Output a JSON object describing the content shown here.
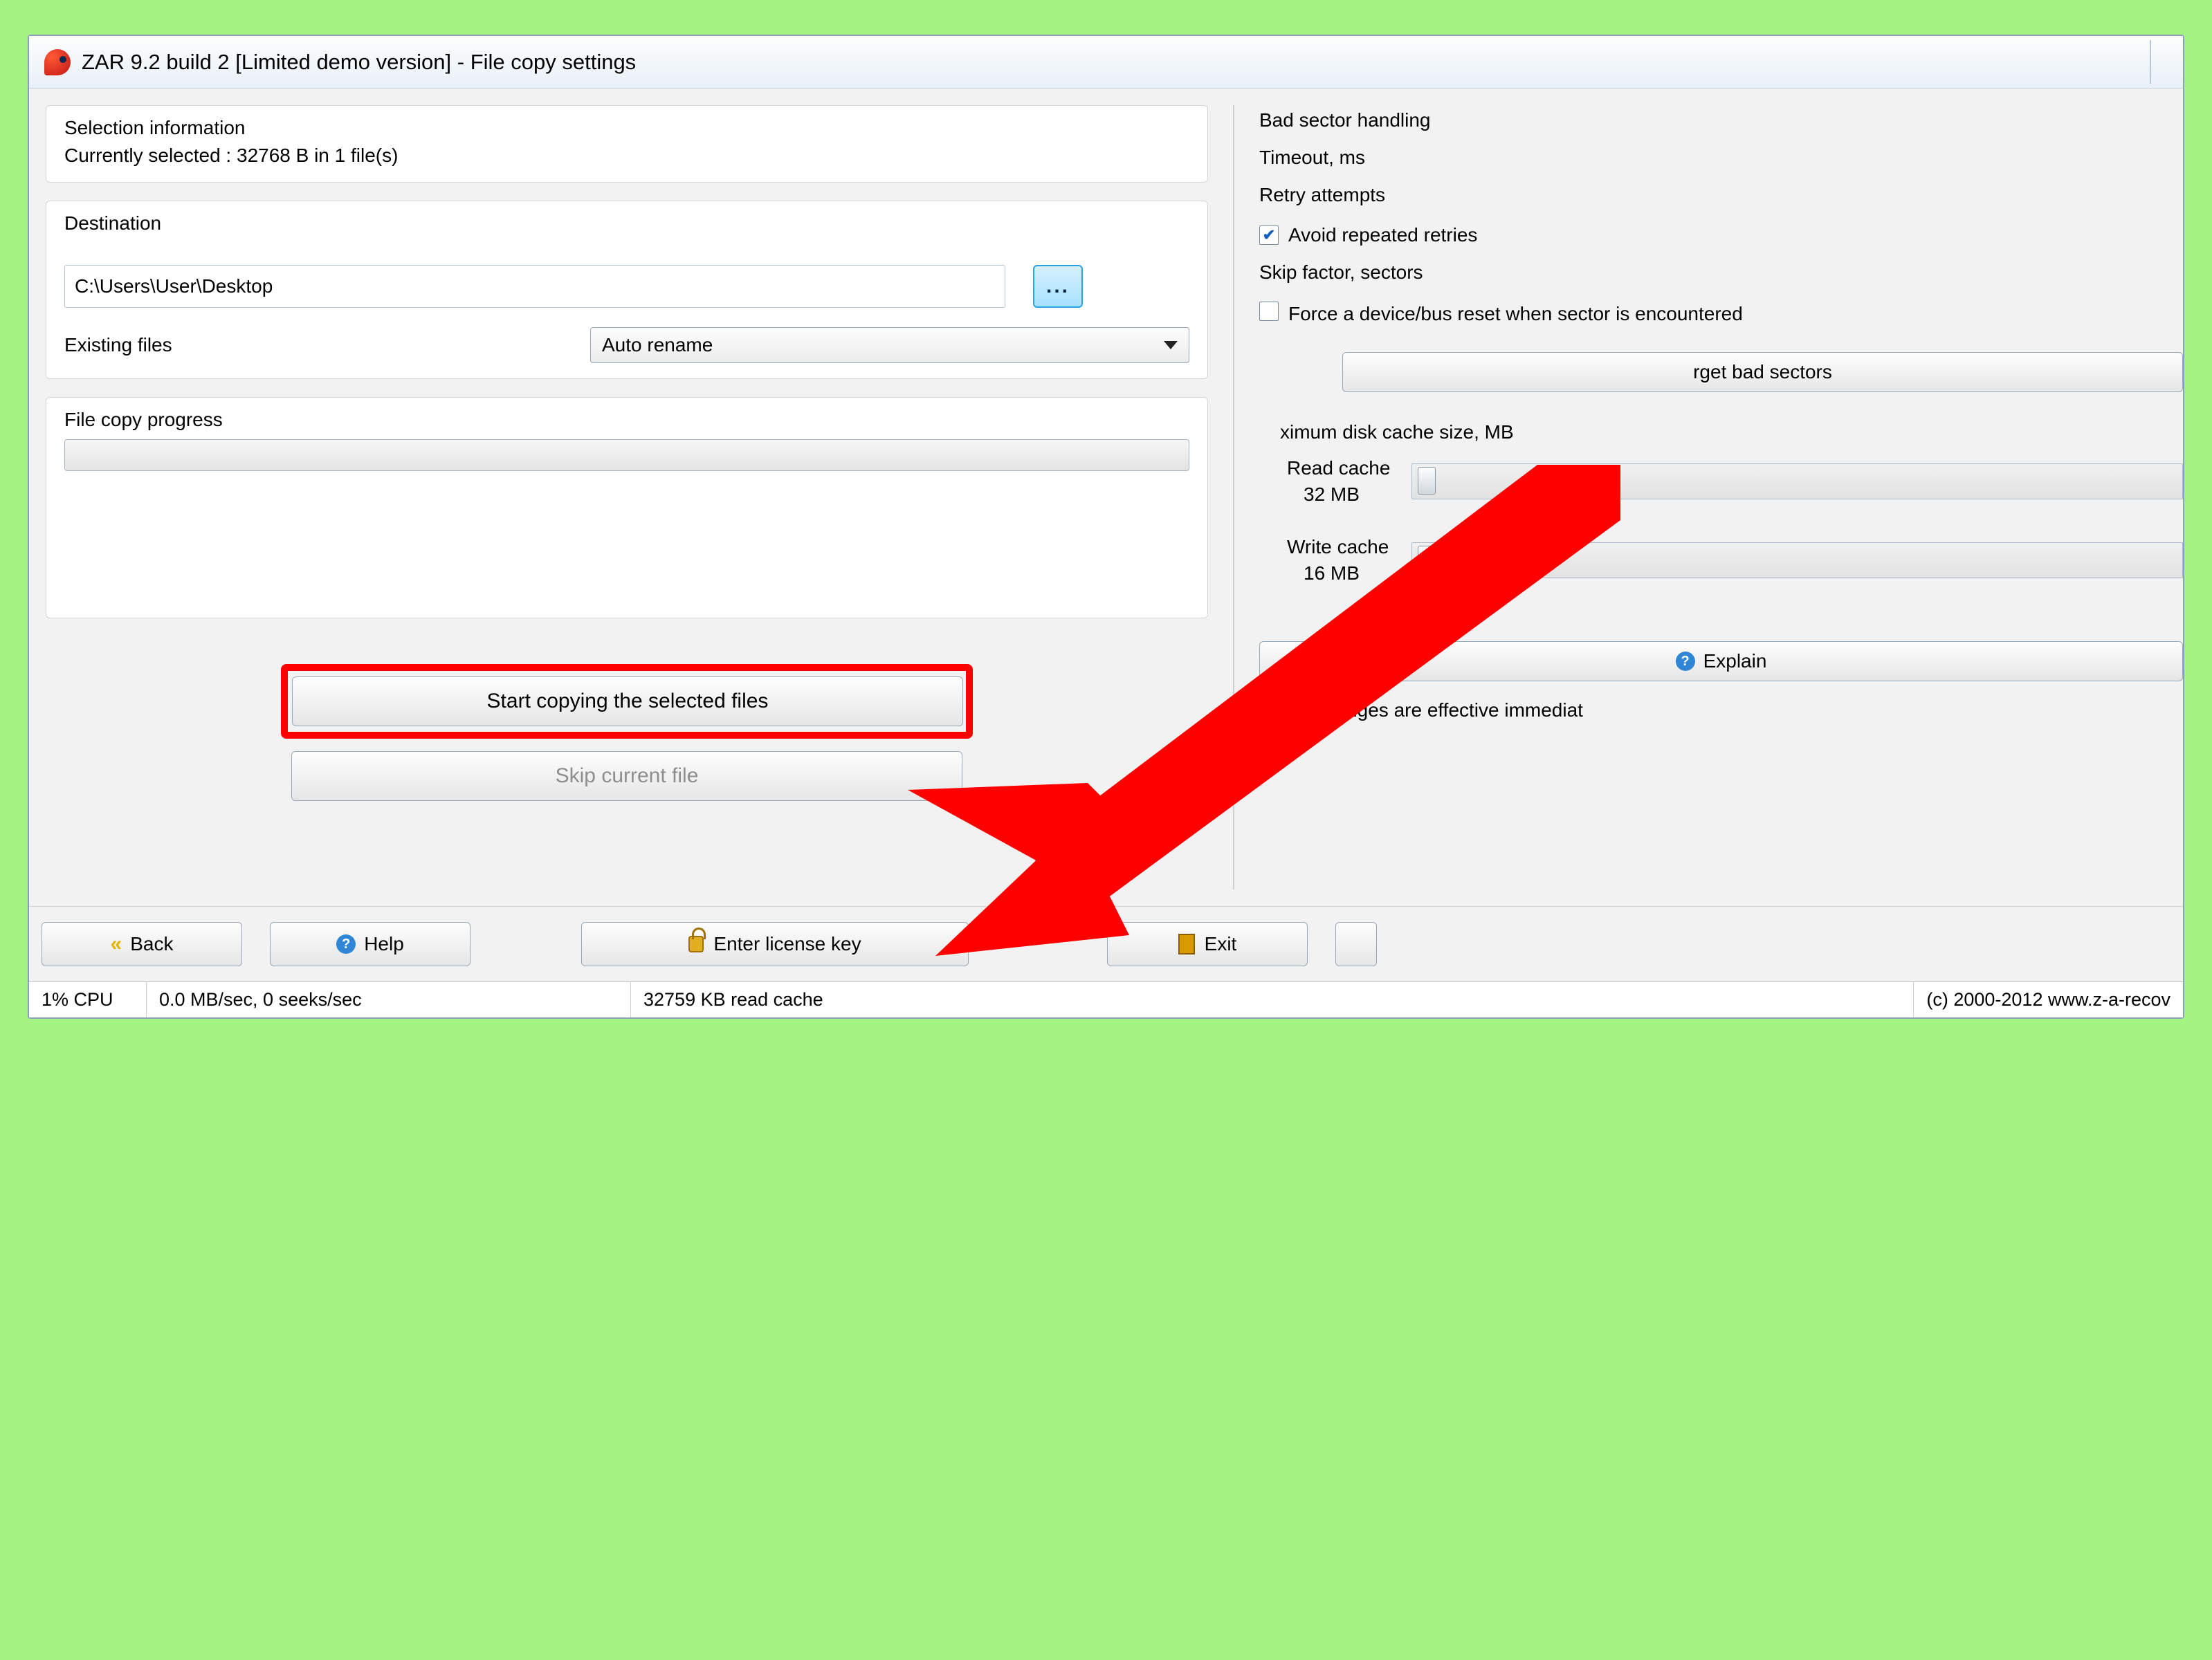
{
  "titlebar": {
    "title": "ZAR 9.2 build 2 [Limited demo version] - File copy settings"
  },
  "selection": {
    "legend": "Selection information",
    "text": "Currently selected : 32768 B in 1 file(s)"
  },
  "destination": {
    "legend": "Destination",
    "path": "C:\\Users\\User\\Desktop",
    "browse_label": "...",
    "existing_label": "Existing files",
    "existing_value": "Auto rename"
  },
  "progress": {
    "legend": "File copy progress"
  },
  "buttons": {
    "start": "Start copying the selected files",
    "skip": "Skip current file"
  },
  "right": {
    "bad_sector_legend": "Bad sector handling",
    "timeout_label": "Timeout, ms",
    "retry_label": "Retry attempts",
    "avoid_label": "Avoid repeated retries",
    "skip_factor_label": "Skip factor, sectors",
    "force_reset_label": "Force a device/bus reset when sector is encountered",
    "forget_btn": "rget bad sectors",
    "cache_size_label": "ximum disk cache size, MB",
    "read_cache_label": "Read cache",
    "read_cache_value": "32 MB",
    "write_cache_label": "Write cache",
    "write_cache_value": "16 MB",
    "explain_btn": "Explain",
    "note": "Note: Changes are effective immediat"
  },
  "footer": {
    "back": "Back",
    "help": "Help",
    "license": "Enter license key",
    "exit": "Exit"
  },
  "status": {
    "cpu": "1% CPU",
    "io": "0.0 MB/sec, 0 seeks/sec",
    "cache": "32759 KB read cache",
    "copyright": "(c) 2000-2012 www.z-a-recov"
  },
  "colors": {
    "highlight": "#ff0000",
    "accent": "#2aa3e2"
  }
}
